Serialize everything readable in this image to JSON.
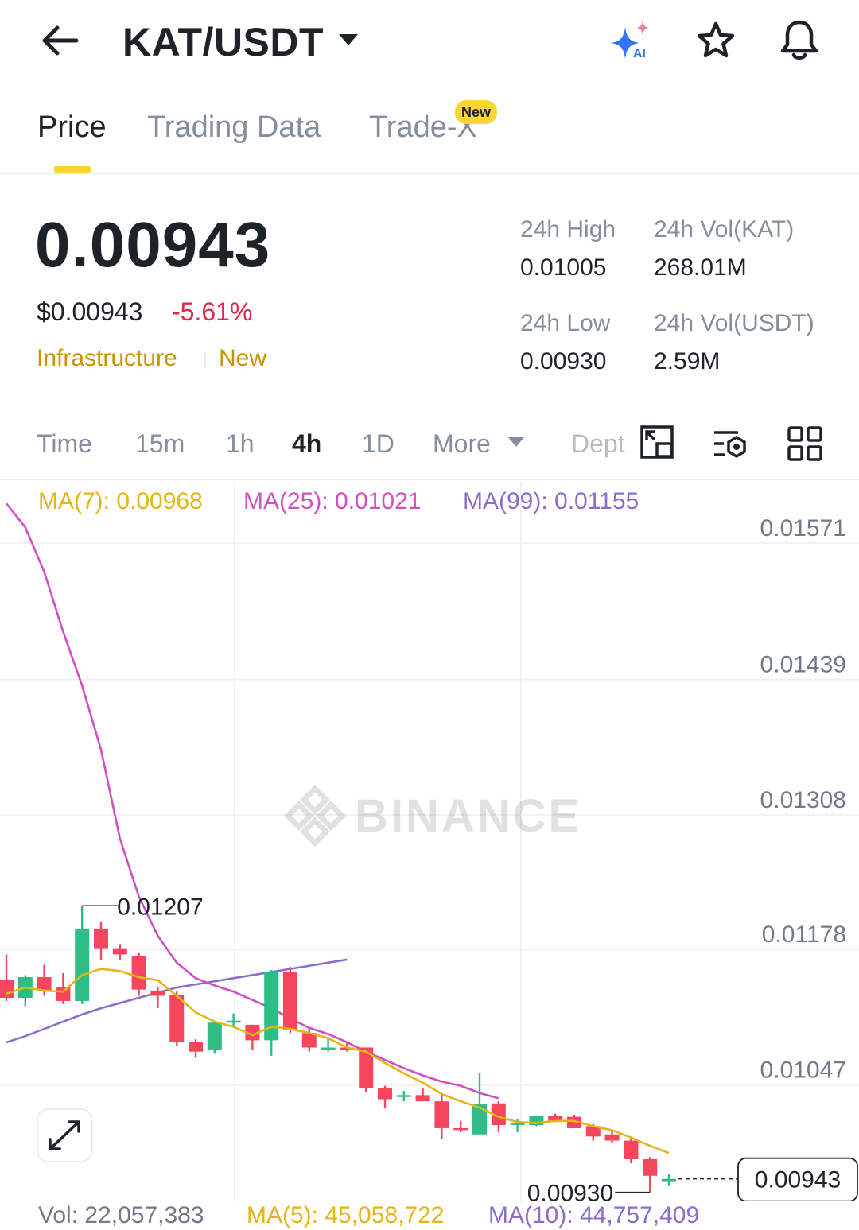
{
  "header": {
    "pair": "KAT/USDT",
    "icons": [
      "back-arrow-icon",
      "caret-down-icon",
      "ai-sparkle-icon",
      "star-icon",
      "bell-icon"
    ]
  },
  "tabs": [
    {
      "label": "Price",
      "active": true
    },
    {
      "label": "Trading Data",
      "active": false
    },
    {
      "label": "Trade-X",
      "active": false,
      "badge": "New"
    }
  ],
  "ticker": {
    "last_price": "0.00943",
    "usd_price": "$0.00943",
    "change_pct": "-5.61%",
    "tags": [
      "Infrastructure",
      "New"
    ],
    "stats": {
      "high_label": "24h High",
      "high_value": "0.01005",
      "vol_base_label": "24h Vol(KAT)",
      "vol_base_value": "268.01M",
      "low_label": "24h Low",
      "low_value": "0.00930",
      "vol_quote_label": "24h Vol(USDT)",
      "vol_quote_value": "2.59M"
    }
  },
  "intervals": {
    "items": [
      "Time",
      "15m",
      "1h",
      "4h",
      "1D",
      "More",
      "Dept"
    ],
    "active": "4h"
  },
  "indicators": {
    "ma7": "MA(7): 0.00968",
    "ma25": "MA(25): 0.01021",
    "ma99": "MA(99): 0.01155"
  },
  "volume": {
    "vol": "Vol: 22,057,383",
    "ma5": "MA(5): 45,058,722",
    "ma10": "MA(10): 44,757,409"
  },
  "watermark": "BINANCE",
  "colors": {
    "up": "#2ebd85",
    "down": "#f6465d",
    "accent": "#fcd535",
    "ma7": "#e5b416",
    "ma25": "#d24fbf",
    "ma99": "#8e6cc9"
  },
  "chart_data": {
    "type": "candlestick",
    "y_ticks": [
      "0.01571",
      "0.01439",
      "0.01308",
      "0.01178",
      "0.01047"
    ],
    "ylim": [
      0.00922,
      0.01597
    ],
    "annotations": {
      "high": "0.01207",
      "low": "0.00930",
      "current": "0.00943"
    },
    "candles": [
      {
        "o": 0.01135,
        "h": 0.0116,
        "l": 0.01115,
        "c": 0.01118
      },
      {
        "o": 0.01118,
        "h": 0.0114,
        "l": 0.0111,
        "c": 0.01138
      },
      {
        "o": 0.01138,
        "h": 0.0115,
        "l": 0.0112,
        "c": 0.01125
      },
      {
        "o": 0.01128,
        "h": 0.01142,
        "l": 0.01112,
        "c": 0.01115
      },
      {
        "o": 0.01115,
        "h": 0.01207,
        "l": 0.01112,
        "c": 0.01185
      },
      {
        "o": 0.01185,
        "h": 0.01192,
        "l": 0.01155,
        "c": 0.01166
      },
      {
        "o": 0.01166,
        "h": 0.0117,
        "l": 0.01155,
        "c": 0.0116
      },
      {
        "o": 0.01158,
        "h": 0.01162,
        "l": 0.0112,
        "c": 0.01126
      },
      {
        "o": 0.01125,
        "h": 0.01128,
        "l": 0.01108,
        "c": 0.0112
      },
      {
        "o": 0.01121,
        "h": 0.01124,
        "l": 0.01072,
        "c": 0.01075
      },
      {
        "o": 0.01075,
        "h": 0.01078,
        "l": 0.0106,
        "c": 0.01066
      },
      {
        "o": 0.01068,
        "h": 0.01096,
        "l": 0.01064,
        "c": 0.01094
      },
      {
        "o": 0.01094,
        "h": 0.01103,
        "l": 0.0109,
        "c": 0.01096
      },
      {
        "o": 0.01092,
        "h": 0.01092,
        "l": 0.01068,
        "c": 0.01077
      },
      {
        "o": 0.01077,
        "h": 0.01145,
        "l": 0.01062,
        "c": 0.01143
      },
      {
        "o": 0.01143,
        "h": 0.01148,
        "l": 0.01084,
        "c": 0.01087
      },
      {
        "o": 0.01084,
        "h": 0.01088,
        "l": 0.01066,
        "c": 0.0107
      },
      {
        "o": 0.01068,
        "h": 0.0108,
        "l": 0.01066,
        "c": 0.0107
      },
      {
        "o": 0.0107,
        "h": 0.01075,
        "l": 0.01066,
        "c": 0.01068
      },
      {
        "o": 0.0107,
        "h": 0.0107,
        "l": 0.01027,
        "c": 0.01031
      },
      {
        "o": 0.01031,
        "h": 0.01033,
        "l": 0.01012,
        "c": 0.0102
      },
      {
        "o": 0.01024,
        "h": 0.01028,
        "l": 0.01018,
        "c": 0.01024
      },
      {
        "o": 0.01024,
        "h": 0.01031,
        "l": 0.01018,
        "c": 0.01018
      },
      {
        "o": 0.01018,
        "h": 0.01024,
        "l": 0.00982,
        "c": 0.00992
      },
      {
        "o": 0.00992,
        "h": 0.00999,
        "l": 0.00988,
        "c": 0.00991
      },
      {
        "o": 0.00986,
        "h": 0.01045,
        "l": 0.00986,
        "c": 0.01015
      },
      {
        "o": 0.01016,
        "h": 0.01018,
        "l": 0.00988,
        "c": 0.00995
      },
      {
        "o": 0.00997,
        "h": 0.01001,
        "l": 0.00988,
        "c": 0.00997
      },
      {
        "o": 0.00995,
        "h": 0.01004,
        "l": 0.00994,
        "c": 0.01004
      },
      {
        "o": 0.01004,
        "h": 0.01006,
        "l": 0.00998,
        "c": 0.00998
      },
      {
        "o": 0.01003,
        "h": 0.01005,
        "l": 0.00992,
        "c": 0.00992
      },
      {
        "o": 0.00994,
        "h": 0.00996,
        "l": 0.0098,
        "c": 0.00984
      },
      {
        "o": 0.00986,
        "h": 0.0099,
        "l": 0.00978,
        "c": 0.0098
      },
      {
        "o": 0.0098,
        "h": 0.00984,
        "l": 0.00958,
        "c": 0.00962
      },
      {
        "o": 0.00962,
        "h": 0.00964,
        "l": 0.0093,
        "c": 0.00946
      },
      {
        "o": 0.0094,
        "h": 0.00948,
        "l": 0.00936,
        "c": 0.00943
      }
    ],
    "ma7_line": [
      0.01122,
      0.01128,
      0.01125,
      0.01124,
      0.0114,
      0.01146,
      0.01144,
      0.01138,
      0.01135,
      0.0112,
      0.01104,
      0.01095,
      0.0109,
      0.01082,
      0.0109,
      0.01088,
      0.01084,
      0.01079,
      0.0107,
      0.01066,
      0.01055,
      0.01045,
      0.01036,
      0.01025,
      0.01018,
      0.01012,
      0.01003,
      0.00998,
      0.00997,
      0.00999,
      0.00999,
      0.00994,
      0.0099,
      0.00983,
      0.00975,
      0.00968
    ],
    "ma25_line": [
      0.01596,
      0.01573,
      0.0153,
      0.01472,
      0.0142,
      0.01358,
      0.01272,
      0.01216,
      0.01178,
      0.01152,
      0.01137,
      0.0113,
      0.01124,
      0.01116,
      0.01108,
      0.01098,
      0.01089,
      0.01083,
      0.01075,
      0.01066,
      0.01058,
      0.0105,
      0.01043,
      0.01037,
      0.01033,
      0.01026,
      0.01021
    ],
    "ma99_line": [
      0.01075,
      0.01081,
      0.01088,
      0.01095,
      0.01102,
      0.01108,
      0.01113,
      0.01118,
      0.01123,
      0.01128,
      0.01131,
      0.01134,
      0.01137,
      0.0114,
      0.01143,
      0.01146,
      0.01149,
      0.01152,
      0.01155
    ]
  }
}
